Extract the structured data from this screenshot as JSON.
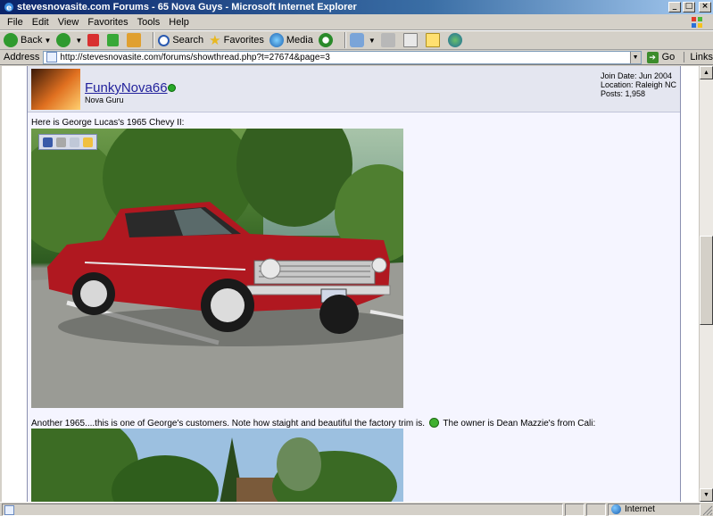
{
  "window": {
    "title": "stevesnovasite.com Forums - 65 Nova Guys - Microsoft Internet Explorer",
    "controls": [
      "_",
      "□",
      "×"
    ]
  },
  "menu": {
    "items": [
      "File",
      "Edit",
      "View",
      "Favorites",
      "Tools",
      "Help"
    ]
  },
  "toolbar": {
    "back_label": "Back",
    "search_label": "Search",
    "favorites_label": "Favorites",
    "media_label": "Media"
  },
  "address": {
    "label": "Address",
    "url": "http://stevesnovasite.com/forums/showthread.php?t=27674&page=3",
    "go_label": "Go",
    "links_label": "Links"
  },
  "post": {
    "username": "FunkyNova66",
    "user_title": "Nova Guru",
    "join_date": "Join Date: Jun 2004",
    "location": "Location: Raleigh NC",
    "posts": "Posts: 1,958",
    "text1": "Here is George Lucas's 1965 Chevy II:",
    "text2_a": "Another 1965....this is one of George's customers. Note how staight and beautiful the factory trim is.",
    "text2_b": "The owner is Dean Mazzie's from Cali:"
  },
  "status": {
    "zone": "Internet"
  },
  "colors": {
    "link": "#22229c",
    "header_bg": "#e4e6f0",
    "car_red": "#b01820"
  }
}
